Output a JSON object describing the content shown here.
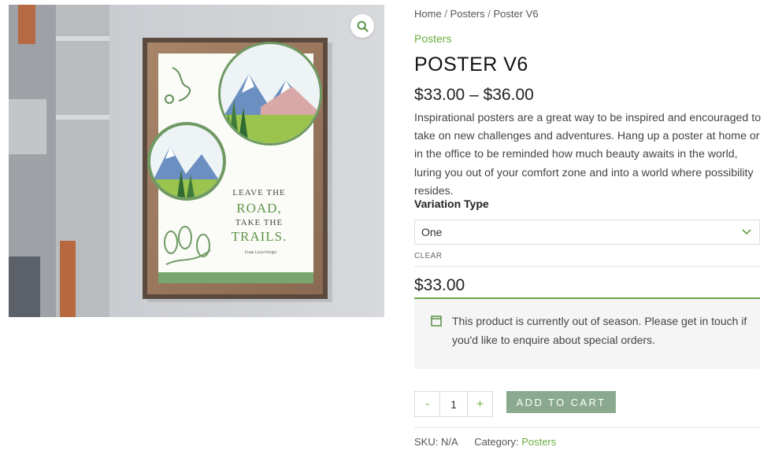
{
  "breadcrumb": {
    "home": "Home",
    "separator": "/",
    "category": "Posters",
    "current": "Poster V6"
  },
  "product": {
    "category_link": "Posters",
    "title": "POSTER V6",
    "price_range": "$33.00 – $36.00",
    "description": "Inspirational posters are a great way to be inspired and encouraged to take on new challenges and adventures. Hang up a poster at home or in the office to be reminded how much beauty awaits in the world, luring you out of your comfort zone and into a world where possibility resides."
  },
  "poster_art": {
    "line1": "LEAVE THE",
    "line2": "ROAD,",
    "line3": "TAKE THE",
    "line4": "TRAILS.",
    "author": "Frank Lloyd Wright"
  },
  "variation": {
    "label": "Variation Type",
    "selected": "One",
    "clear_label": "CLEAR",
    "price": "$33.00"
  },
  "notice": {
    "text": "This product is currently out of season. Please get in touch if you'd like to enquire about special orders."
  },
  "cart": {
    "minus": "-",
    "quantity": "1",
    "plus": "+",
    "add_label": "ADD TO CART"
  },
  "meta": {
    "sku_label": "SKU:",
    "sku_value": "N/A",
    "category_label": "Category:",
    "category_value": "Posters"
  },
  "colors": {
    "accent_green": "#6cae3f",
    "button_green": "#8aa98e",
    "notice_border": "#6aa84f"
  },
  "icons": {
    "zoom": "magnifier-icon",
    "select": "chevron-down-icon",
    "notice": "window-icon"
  }
}
